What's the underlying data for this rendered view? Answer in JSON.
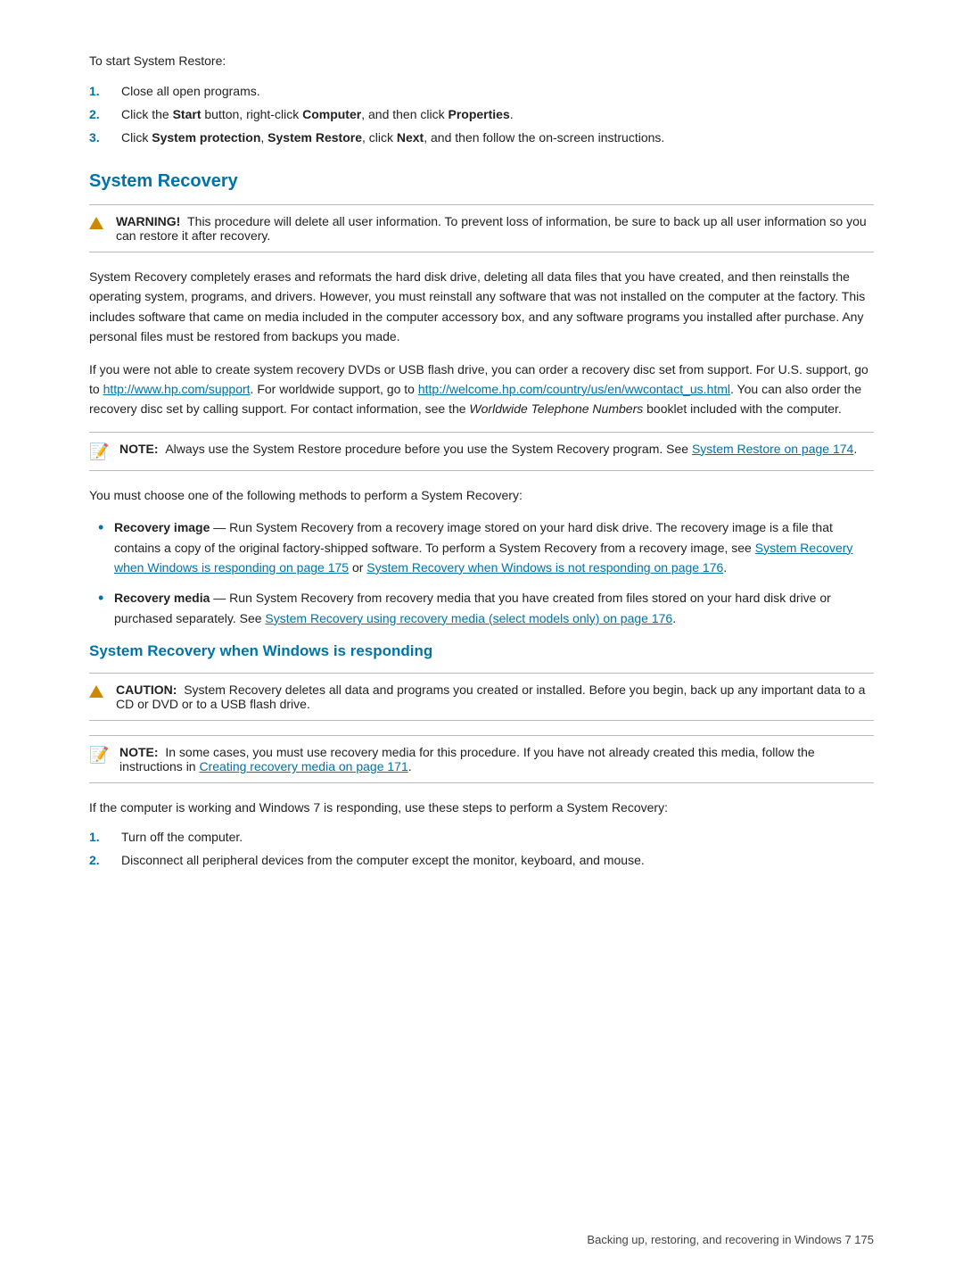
{
  "intro": {
    "text": "To start System Restore:"
  },
  "steps_initial": [
    {
      "num": "1.",
      "text": "Close all open programs."
    },
    {
      "num": "2.",
      "text_parts": [
        {
          "text": "Click the "
        },
        {
          "bold": "Start"
        },
        {
          "text": " button, right-click "
        },
        {
          "bold": "Computer"
        },
        {
          "text": ", and then click "
        },
        {
          "bold": "Properties"
        },
        {
          "text": "."
        }
      ]
    },
    {
      "num": "3.",
      "text_parts": [
        {
          "text": "Click "
        },
        {
          "bold": "System protection"
        },
        {
          "text": ", "
        },
        {
          "bold": "System Restore"
        },
        {
          "text": ", click "
        },
        {
          "bold": "Next"
        },
        {
          "text": ", and then follow the on-screen instructions."
        }
      ]
    }
  ],
  "system_recovery": {
    "heading": "System Recovery",
    "warning": {
      "label": "WARNING!",
      "text": "This procedure will delete all user information. To prevent loss of information, be sure to back up all user information so you can restore it after recovery."
    },
    "para1": "System Recovery completely erases and reformats the hard disk drive, deleting all data files that you have created, and then reinstalls the operating system, programs, and drivers. However, you must reinstall any software that was not installed on the computer at the factory. This includes software that came on media included in the computer accessory box, and any software programs you installed after purchase. Any personal files must be restored from backups you made.",
    "para2_parts": [
      {
        "text": "If you were not able to create system recovery DVDs or USB flash drive, you can order a recovery disc set from support. For U.S. support, go to "
      },
      {
        "link": "http://www.hp.com/support",
        "display": "http://www.hp.com/support"
      },
      {
        "text": ". For worldwide support, go to "
      },
      {
        "link": "http://welcome.hp.com/country/us/en/wwcontact_us.html",
        "display": "http://welcome.hp.com/country/us/en/wwcontact_us.html"
      },
      {
        "text": ". You can also order the recovery disc set by calling support. For contact information, see the "
      },
      {
        "italic": "Worldwide Telephone Numbers"
      },
      {
        "text": " booklet included with the computer."
      }
    ],
    "note": {
      "label": "NOTE:",
      "text_parts": [
        {
          "text": "Always use the System Restore procedure before you use the System Recovery program. See "
        },
        {
          "link": "System Restore on page 174",
          "display": "System Restore on page 174"
        },
        {
          "text": "."
        }
      ]
    },
    "para3": "You must choose one of the following methods to perform a System Recovery:",
    "bullets": [
      {
        "text_parts": [
          {
            "bold": "Recovery image"
          },
          {
            "text": " — Run System Recovery from a recovery image stored on your hard disk drive. The recovery image is a file that contains a copy of the original factory-shipped software. To perform a System Recovery from a recovery image, see "
          },
          {
            "link": "System Recovery when Windows is responding on page 175",
            "display": "System Recovery when Windows is responding on page 175"
          },
          {
            "text": " or "
          },
          {
            "link": "System Recovery when Windows is not responding on page 176",
            "display": "System Recovery when Windows is not responding on page 176"
          },
          {
            "text": "."
          }
        ]
      },
      {
        "text_parts": [
          {
            "bold": "Recovery media"
          },
          {
            "text": " — Run System Recovery from recovery media that you have created from files stored on your hard disk drive or purchased separately. See "
          },
          {
            "link": "System Recovery using recovery media (select models only) on page 176",
            "display": "System Recovery using recovery media (select models only) on page 176"
          },
          {
            "text": "."
          }
        ]
      }
    ]
  },
  "system_recovery_responding": {
    "heading": "System Recovery when Windows is responding",
    "caution": {
      "label": "CAUTION:",
      "text": "System Recovery deletes all data and programs you created or installed. Before you begin, back up any important data to a CD or DVD or to a USB flash drive."
    },
    "note": {
      "label": "NOTE:",
      "text_parts": [
        {
          "text": "In some cases, you must use recovery media for this procedure. If you have not already created this media, follow the instructions in "
        },
        {
          "link": "Creating recovery media on page 171",
          "display": "Creating recovery media on page 171"
        },
        {
          "text": "."
        }
      ]
    },
    "para1": "If the computer is working and Windows 7 is responding, use these steps to perform a System Recovery:",
    "steps": [
      {
        "num": "1.",
        "text": "Turn off the computer."
      },
      {
        "num": "2.",
        "text": "Disconnect all peripheral devices from the computer except the monitor, keyboard, and mouse."
      }
    ]
  },
  "footer": {
    "text": "Backing up, restoring, and recovering in Windows 7     175"
  }
}
